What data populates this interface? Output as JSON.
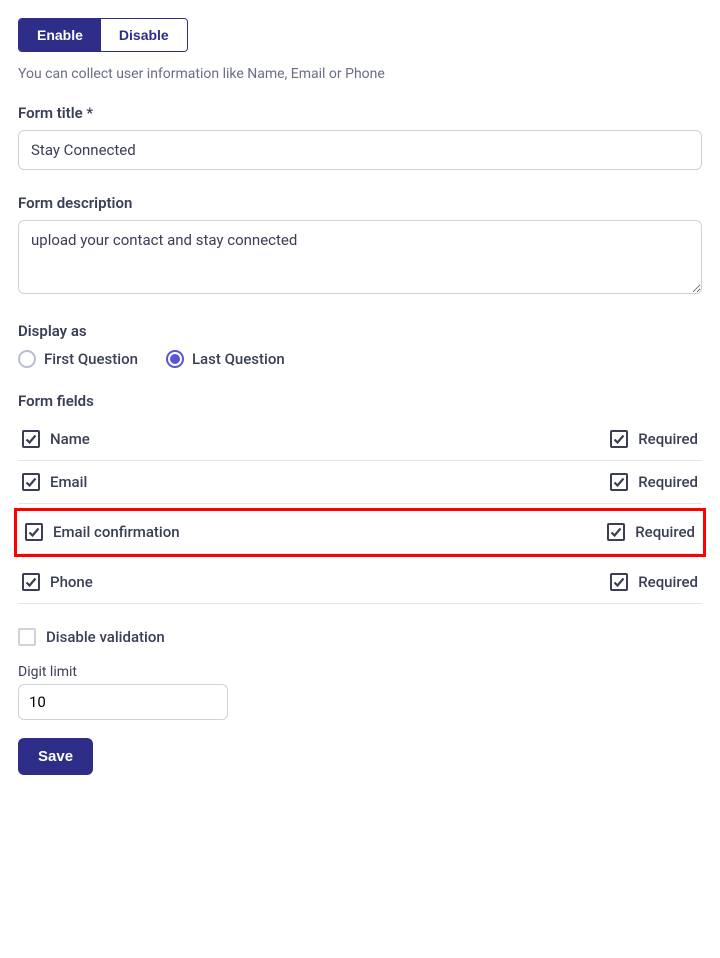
{
  "toggle": {
    "enable": "Enable",
    "disable": "Disable",
    "active": "enable"
  },
  "helper_text": "You can collect user information like Name, Email or Phone",
  "form_title": {
    "label": "Form title *",
    "value": "Stay Connected"
  },
  "form_description": {
    "label": "Form description",
    "value": "upload your contact and stay connected"
  },
  "display_as": {
    "label": "Display as",
    "options": [
      {
        "label": "First Question",
        "selected": false
      },
      {
        "label": "Last Question",
        "selected": true
      }
    ]
  },
  "form_fields": {
    "label": "Form fields",
    "required_label": "Required",
    "items": [
      {
        "name": "Name",
        "checked": true,
        "required_checked": true,
        "highlight": false
      },
      {
        "name": "Email",
        "checked": true,
        "required_checked": true,
        "highlight": false
      },
      {
        "name": "Email confirmation",
        "checked": true,
        "required_checked": true,
        "highlight": true
      },
      {
        "name": "Phone",
        "checked": true,
        "required_checked": true,
        "highlight": false
      }
    ]
  },
  "disable_validation": {
    "label": "Disable validation",
    "checked": false
  },
  "digit_limit": {
    "label": "Digit limit",
    "value": "10"
  },
  "save_label": "Save"
}
